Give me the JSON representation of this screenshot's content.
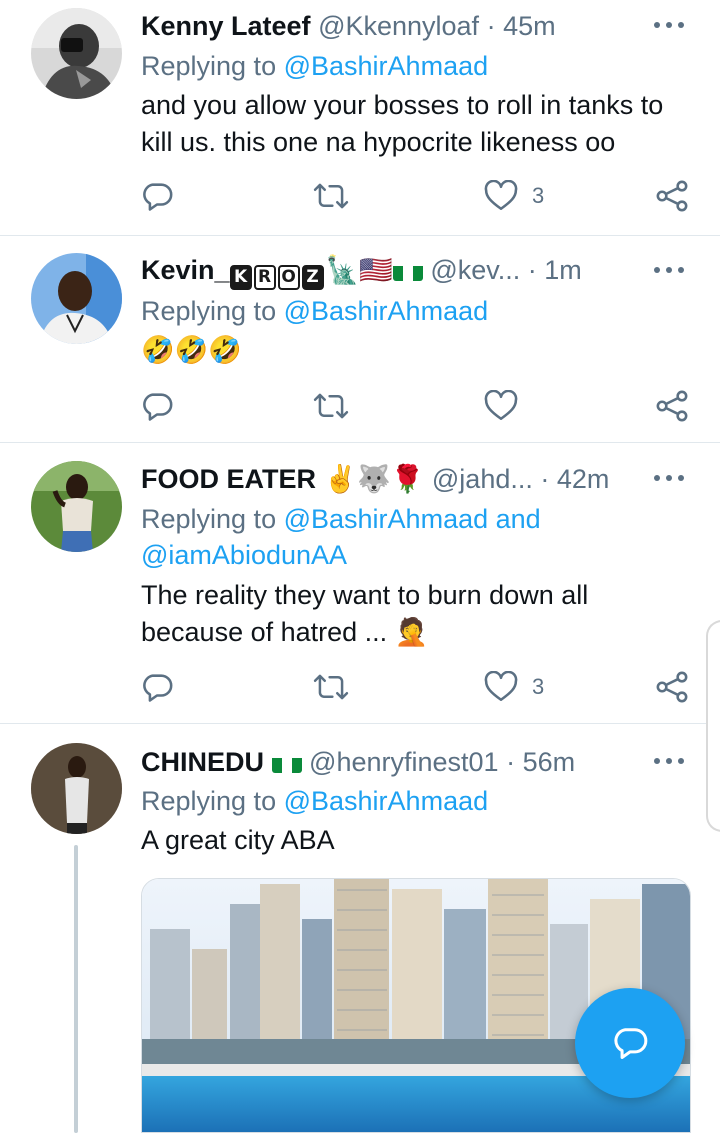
{
  "tweets": [
    {
      "name": "Kenny Lateef",
      "handle": "@Kkennyloaf",
      "dot": "·",
      "time": "45m",
      "replying_prefix": "Replying to",
      "replying_to": "@BashirAhmaad",
      "text": "and you allow your bosses to roll in tanks to kill us. this one na hypocrite likeness oo",
      "likes": "3"
    },
    {
      "name": "Kevin_",
      "name_badge": [
        "K",
        "R",
        "O",
        "Z"
      ],
      "name_emoji": "🗽🇺🇸",
      "handle": "@kev...",
      "dot": "·",
      "time": "1m",
      "replying_prefix": "Replying to",
      "replying_to": "@BashirAhmaad",
      "text": "🤣🤣🤣",
      "likes": ""
    },
    {
      "name": "FOOD EATER",
      "name_emoji": "✌️🐺🌹",
      "handle": "@jahd...",
      "dot": "·",
      "time": "42m",
      "replying_prefix": "Replying to",
      "replying_to": "@BashirAhmaad and @iamAbiodunAA",
      "text_line1": "The reality they want to burn down all",
      "text_line2": "because of hatred ... 🤦",
      "likes": "3"
    },
    {
      "name": "CHINEDU",
      "handle": "@henryfinest01",
      "dot": "·",
      "time": "56m",
      "replying_prefix": "Replying to",
      "replying_to": "@BashirAhmaad",
      "text": "A great city ABA"
    }
  ],
  "icons": {
    "reply": "reply-icon",
    "retweet": "retweet-icon",
    "like": "heart-icon",
    "share": "share-icon",
    "more": "more-icon",
    "compose": "compose-reply-icon"
  },
  "colors": {
    "accent": "#1da1f2",
    "secondary_text": "#5b7083",
    "divider": "#e1e8ed"
  }
}
